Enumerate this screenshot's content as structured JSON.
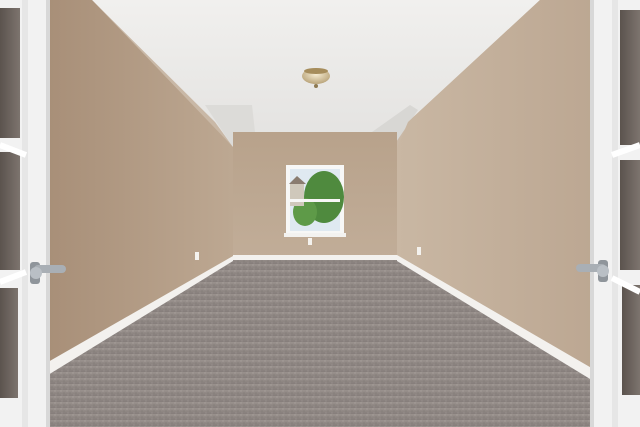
{
  "scene": {
    "subject": "empty-room",
    "palette": {
      "ceiling": "#e9e8e6",
      "ceiling_shadow": "#d6d5d2",
      "wall_left": "#b49d86",
      "wall_right": "#c5b19c",
      "wall_back": "#bba690",
      "baseboard": "#f4f2ef",
      "carpet": "#8f8784",
      "carpet_light": "#a29a96",
      "door_frame": "#f2f2f2",
      "glass": "#6f6660",
      "handle": "#9aa0a6",
      "foliage": "#4f8a3e",
      "sky": "#dfe9f1",
      "light_fixture": "#d9c9a3"
    }
  }
}
